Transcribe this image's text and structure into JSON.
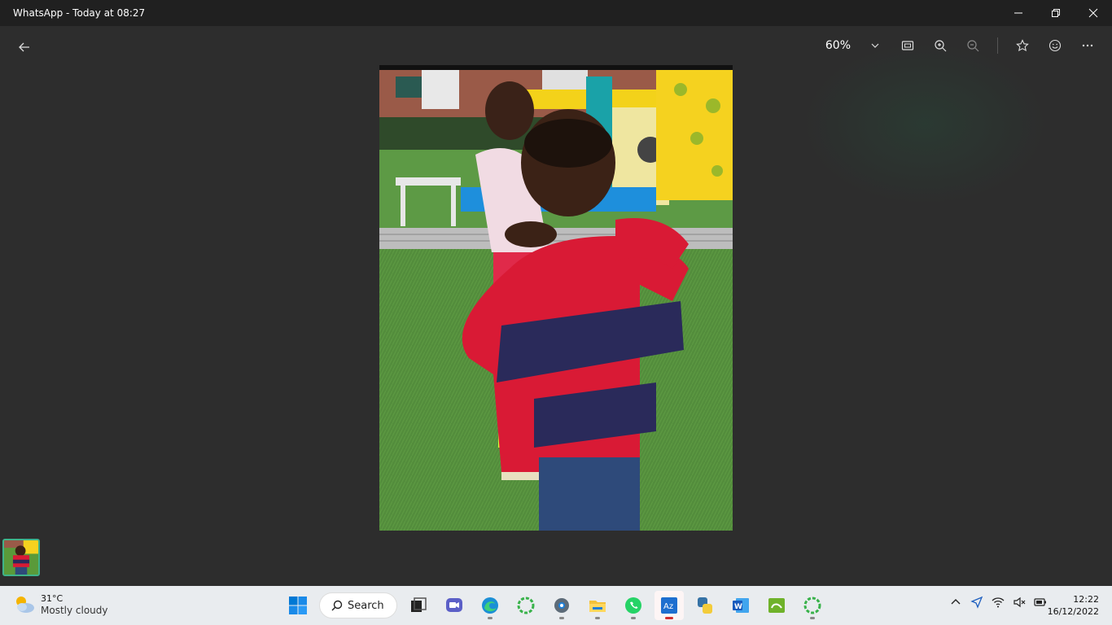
{
  "window": {
    "title": "WhatsApp - Today at 08:27"
  },
  "viewer": {
    "zoom_label": "60%"
  },
  "taskbar": {
    "weather": {
      "temp": "31°C",
      "condition": "Mostly cloudy"
    },
    "search_label": "Search",
    "clock": {
      "time": "12:22",
      "date": "16/12/2022"
    },
    "pinned_apps": [
      {
        "name": "start-icon"
      },
      {
        "name": "task-view-icon"
      },
      {
        "name": "teams-chat-icon"
      },
      {
        "name": "edge-icon"
      },
      {
        "name": "green-ring-app-icon"
      },
      {
        "name": "settings-icon"
      },
      {
        "name": "file-explorer-icon"
      },
      {
        "name": "whatsapp-icon"
      },
      {
        "name": "azure-data-studio-icon"
      },
      {
        "name": "python-icon"
      },
      {
        "name": "word-icon"
      },
      {
        "name": "sims-app-icon"
      },
      {
        "name": "green-ring-app-icon-2"
      }
    ]
  },
  "colors": {
    "accent": "#0078d4",
    "thumb_border": "#3fb38a",
    "titlebar": "#202020",
    "stage": "#2d2d2d"
  }
}
